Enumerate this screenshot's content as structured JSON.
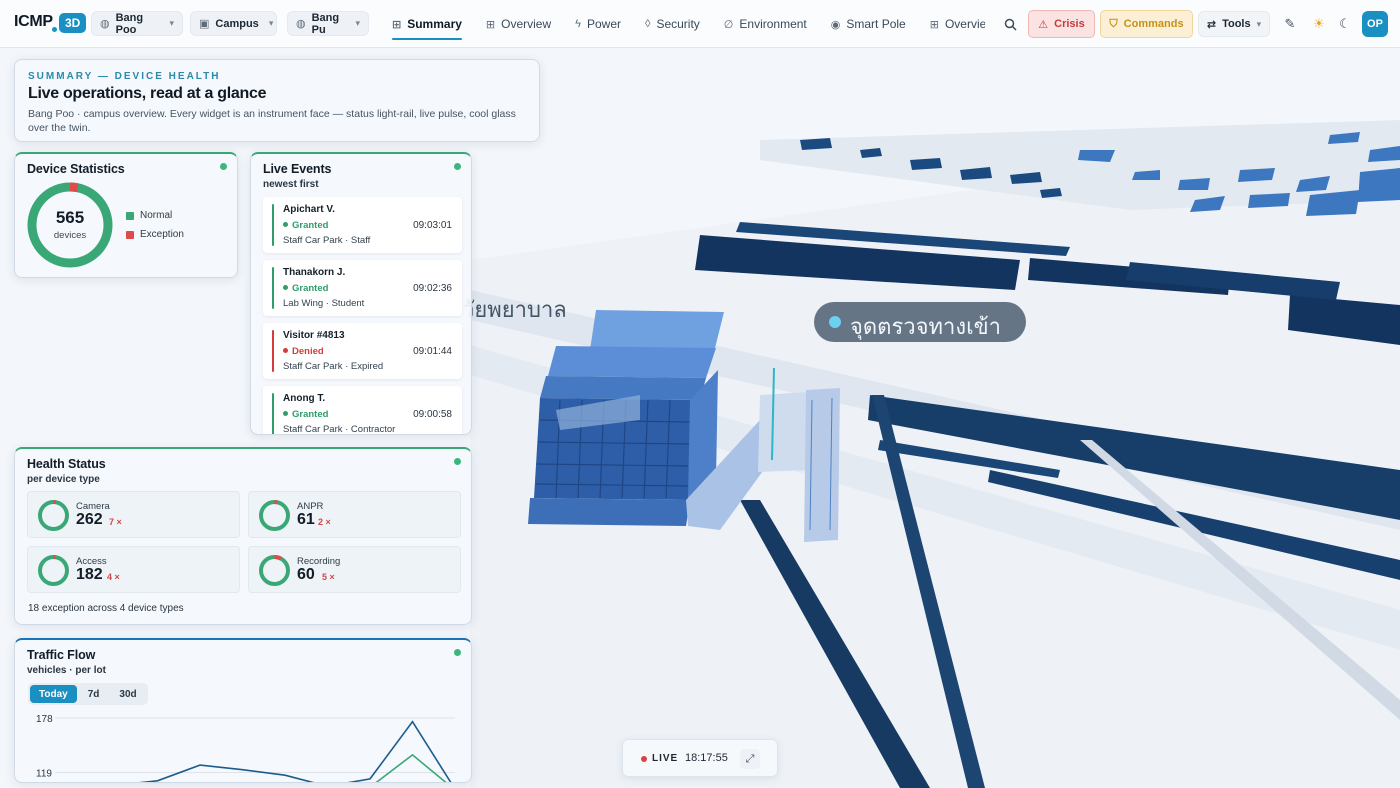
{
  "app": {
    "logo": "ICMP",
    "mode_badge": "3D",
    "selectors": [
      {
        "icon": "globe-icon",
        "label": "Bang Poo"
      },
      {
        "icon": "building-icon",
        "label": "Campus"
      },
      {
        "icon": "globe-icon",
        "label": "Bang Pu"
      }
    ],
    "nav": [
      {
        "icon": "grid-icon",
        "label": "Summary",
        "active": true
      },
      {
        "icon": "grid-icon",
        "label": "Overview"
      },
      {
        "icon": "bolt-icon",
        "label": "Power"
      },
      {
        "icon": "shield-icon",
        "label": "Security"
      },
      {
        "icon": "leaf-icon",
        "label": "Environment"
      },
      {
        "icon": "signal-icon",
        "label": "Smart Pole"
      },
      {
        "icon": "grid-icon",
        "label": "Overview H"
      }
    ],
    "actions": {
      "crisis": "Crisis",
      "commands": "Commands",
      "tools": "Tools",
      "avatar": "OP"
    }
  },
  "summary": {
    "eyebrow": "SUMMARY — DEVICE HEALTH",
    "title": "Live operations, read at a glance",
    "description": "Bang Poo · campus overview. Every widget is an instrument face — status light-rail, live pulse, cool glass over the twin."
  },
  "device_statistics": {
    "title": "Device Statistics",
    "total": "565",
    "total_unit": "devices",
    "exception_fraction": 0.032,
    "legend": [
      {
        "label": "Normal",
        "color": "#3aa876"
      },
      {
        "label": "Exception",
        "color": "#e04a4a"
      }
    ]
  },
  "live_events": {
    "title": "Live Events",
    "subtitle": "newest first",
    "items": [
      {
        "name": "Apichart V.",
        "status": "Granted",
        "time": "09:03:01",
        "location": "Staff Car Park · Staff"
      },
      {
        "name": "Thanakorn J.",
        "status": "Granted",
        "time": "09:02:36",
        "location": "Lab Wing · Student"
      },
      {
        "name": "Visitor #4813",
        "status": "Denied",
        "time": "09:01:44",
        "location": "Staff Car Park · Expired"
      },
      {
        "name": "Anong T.",
        "status": "Granted",
        "time": "09:00:58",
        "location": "Staff Car Park · Contractor"
      }
    ]
  },
  "health_status": {
    "title": "Health Status",
    "subtitle": "per device type",
    "items": [
      {
        "label": "Camera",
        "value": "262",
        "exceptions": "7 ×",
        "exception_fraction": 0.026
      },
      {
        "label": "ANPR",
        "value": "61",
        "exceptions": "2 ×",
        "exception_fraction": 0.032
      },
      {
        "label": "Access",
        "value": "182",
        "exceptions": "4 ×",
        "exception_fraction": 0.022
      },
      {
        "label": "Recording",
        "value": "60",
        "exceptions": "5 ×",
        "exception_fraction": 0.077
      }
    ],
    "footer": "18 exception across 4 device types"
  },
  "traffic_flow": {
    "title": "Traffic Flow",
    "subtitle": "vehicles · per lot",
    "ranges": [
      "Today",
      "7d",
      "30d"
    ],
    "active_range": "Today",
    "chart_data": {
      "type": "line",
      "y_ticks": [
        "178",
        "119"
      ],
      "ylim": [
        100,
        178
      ],
      "series": [
        {
          "color": "#1d5c8c",
          "values": [
            105,
            110,
            127,
            122,
            116,
            104,
            112,
            174,
            101
          ]
        },
        {
          "color": "#3aa876",
          "values": [
            100,
            101,
            103,
            104,
            102,
            100,
            103,
            138,
            100
          ]
        }
      ]
    }
  },
  "livebar": {
    "label": "LIVE",
    "time": "18:17:55"
  },
  "scene": {
    "label_main": "จุดตรวจทางเข้า",
    "label_secondary": "วัยพยาบาล"
  },
  "colors": {
    "accent": "#1a8fc2",
    "normal": "#3aa876",
    "exception": "#e04a4a",
    "granted": "#2e9e6b",
    "denied": "#d43c3c"
  }
}
